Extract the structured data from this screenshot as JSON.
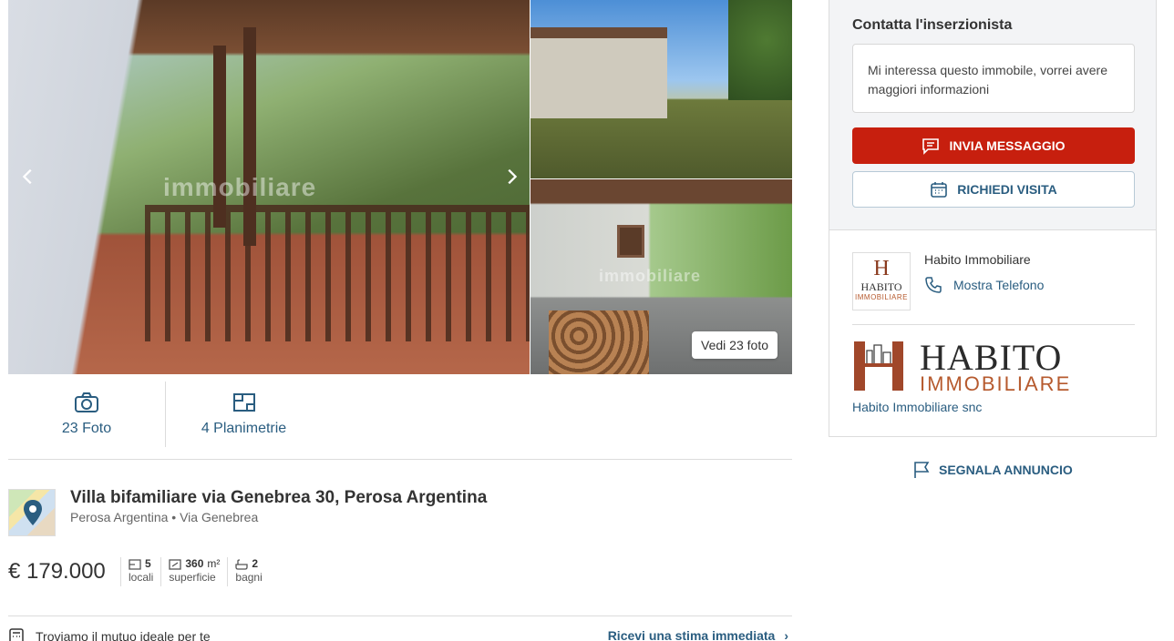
{
  "gallery": {
    "see_all_label": "Vedi 23 foto",
    "watermark": "immobiliare"
  },
  "media_tabs": [
    {
      "label": "23 Foto",
      "icon": "camera-icon"
    },
    {
      "label": "4 Planimetrie",
      "icon": "floorplan-icon"
    }
  ],
  "listing": {
    "title": "Villa bifamiliare via Genebrea 30, Perosa Argentina",
    "city": "Perosa Argentina",
    "street": "Via Genebrea",
    "price": "€ 179.000",
    "features": [
      {
        "value": "5",
        "unit": "",
        "label": "locali",
        "icon": "rooms-icon"
      },
      {
        "value": "360",
        "unit": "m²",
        "label": "superficie",
        "icon": "area-icon"
      },
      {
        "value": "2",
        "unit": "",
        "label": "bagni",
        "icon": "bath-icon"
      }
    ]
  },
  "mortgage": {
    "text": "Troviamo il mutuo ideale per te",
    "link": "Ricevi una stima immediata"
  },
  "contact": {
    "title": "Contatta l'inserzionista",
    "message": "Mi interessa questo immobile, vorrei avere maggiori informazioni",
    "send_label": "INVIA MESSAGGIO",
    "visit_label": "RICHIEDI VISITA"
  },
  "agency": {
    "name": "Habito Immobiliare",
    "phone_label": "Mostra Telefono",
    "logo_word1": "HABITO",
    "logo_word2": "IMMOBILIARE",
    "full_name": "Habito Immobiliare snc"
  },
  "report_label": "SEGNALA ANNUNCIO",
  "colors": {
    "accent_red": "#c71f0e",
    "link_blue": "#2a5d80",
    "brand_brown": "#8a3a1e"
  }
}
